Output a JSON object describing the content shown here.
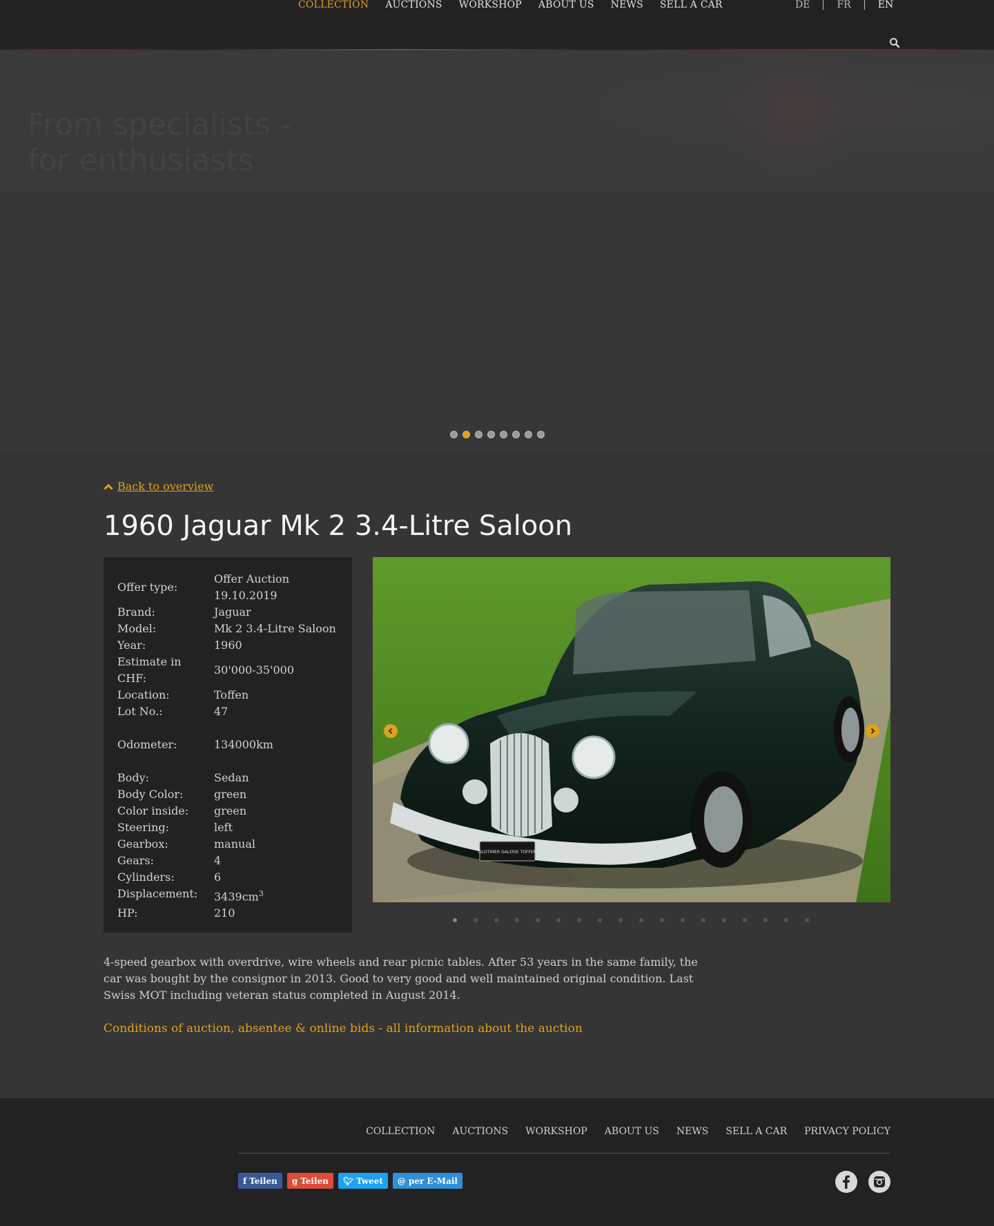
{
  "nav": {
    "items": [
      "COLLECTION",
      "AUCTIONS",
      "WORKSHOP",
      "ABOUT US",
      "NEWS",
      "SELL A CAR"
    ],
    "active": "COLLECTION"
  },
  "lang": {
    "de": "DE",
    "fr": "FR",
    "en": "EN",
    "current": "EN"
  },
  "hero": {
    "title_line1": "From specialists -",
    "title_line2": "for enthusiasts",
    "slide_count": 8,
    "active_slide": 2
  },
  "back_label": "Back to overview",
  "car_title": "1960 Jaguar Mk 2 3.4-Litre Saloon",
  "specs": {
    "offer_type": {
      "label": "Offer type:",
      "value1": "Offer Auction",
      "value2": "19.10.2019"
    },
    "brand": {
      "label": "Brand:",
      "value": "Jaguar"
    },
    "model": {
      "label": "Model:",
      "value": "Mk 2 3.4-Litre Saloon"
    },
    "year": {
      "label": "Year:",
      "value": "1960"
    },
    "estimate": {
      "label1": "Estimate in",
      "label2": "CHF:",
      "value": "30'000-35'000"
    },
    "location": {
      "label": "Location:",
      "value": "Toffen"
    },
    "lot": {
      "label": "Lot No.:",
      "value": "47"
    },
    "odometer": {
      "label": "Odometer:",
      "value": "134000km"
    },
    "body": {
      "label": "Body:",
      "value": "Sedan"
    },
    "body_color": {
      "label": "Body Color:",
      "value": "green"
    },
    "color_inside": {
      "label": "Color inside:",
      "value": "green"
    },
    "steering": {
      "label": "Steering:",
      "value": "left"
    },
    "gearbox": {
      "label": "Gearbox:",
      "value": "manual"
    },
    "gears": {
      "label": "Gears:",
      "value": "4"
    },
    "cylinders": {
      "label": "Cylinders:",
      "value": "6"
    },
    "displacement": {
      "label": "Displacement:",
      "value": "3439cm",
      "unit_sup": "3"
    },
    "hp": {
      "label": "HP:",
      "value": "210"
    }
  },
  "photo": {
    "plate_text": "OLDTIMER GALERIE TOFFEN",
    "dots_count": 18,
    "active_dot": 1
  },
  "description": "4-speed gearbox with overdrive, wire wheels and rear picnic tables. After 53 years in the same family, the car was bought by the consignor in 2013. Good to very good and well maintained original condition. Last Swiss MOT including veteran status completed in August 2014.",
  "links": {
    "conditions": "Conditions of auction, absentee & online bids",
    "separator": "-",
    "info": "all information about the auction"
  },
  "footer": {
    "nav": [
      "COLLECTION",
      "AUCTIONS",
      "WORKSHOP",
      "ABOUT US",
      "NEWS",
      "SELL A CAR",
      "PRIVACY POLICY"
    ],
    "share": {
      "facebook": "Teilen",
      "google": "Teilen",
      "twitter": "Tweet",
      "email": "per E-Mail"
    }
  },
  "colors": {
    "accent": "#e0a21c",
    "background": "#353535",
    "panel": "#222222"
  }
}
